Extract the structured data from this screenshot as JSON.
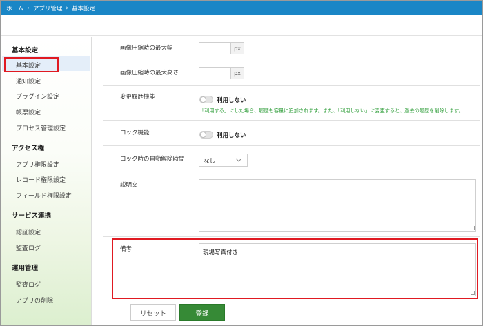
{
  "breadcrumb": [
    "ホーム",
    "アプリ管理",
    "基本設定"
  ],
  "breadcrumb_separator": "›",
  "sidebar": {
    "sections": [
      {
        "title": "基本設定",
        "items": [
          "基本設定",
          "通知設定",
          "プラグイン設定",
          "帳票設定",
          "プロセス管理設定"
        ]
      },
      {
        "title": "アクセス権",
        "items": [
          "アプリ権限設定",
          "レコード権限設定",
          "フィールド権限設定"
        ]
      },
      {
        "title": "サービス連携",
        "items": [
          "認証設定",
          "監査ログ"
        ]
      },
      {
        "title": "運用管理",
        "items": [
          "監査ログ",
          "アプリの削除"
        ]
      }
    ],
    "active_item": "基本設定"
  },
  "form": {
    "max_width_label": "画像圧縮時の最大幅",
    "max_width_value": "",
    "max_height_label": "画像圧縮時の最大高さ",
    "max_height_value": "",
    "unit": "px",
    "history_label": "変更履歴機能",
    "history_toggle_text": "利用しない",
    "history_note": "「利用する」にした場合、履歴も容量に追加されます。また、「利用しない」に変更すると、過去の履歴を削除します。",
    "lock_label": "ロック機能",
    "lock_toggle_text": "利用しない",
    "auto_unlock_label": "ロック時の自動解除時間",
    "auto_unlock_value": "なし",
    "description_label": "説明文",
    "description_value": "",
    "remarks_label": "備考",
    "remarks_value": "現場写真付き"
  },
  "buttons": {
    "reset": "リセット",
    "save": "登録"
  },
  "colors": {
    "header": "#1a86c6",
    "highlight": "#e01a22",
    "save_button": "#368a36",
    "note_text": "#2f9e3a"
  }
}
